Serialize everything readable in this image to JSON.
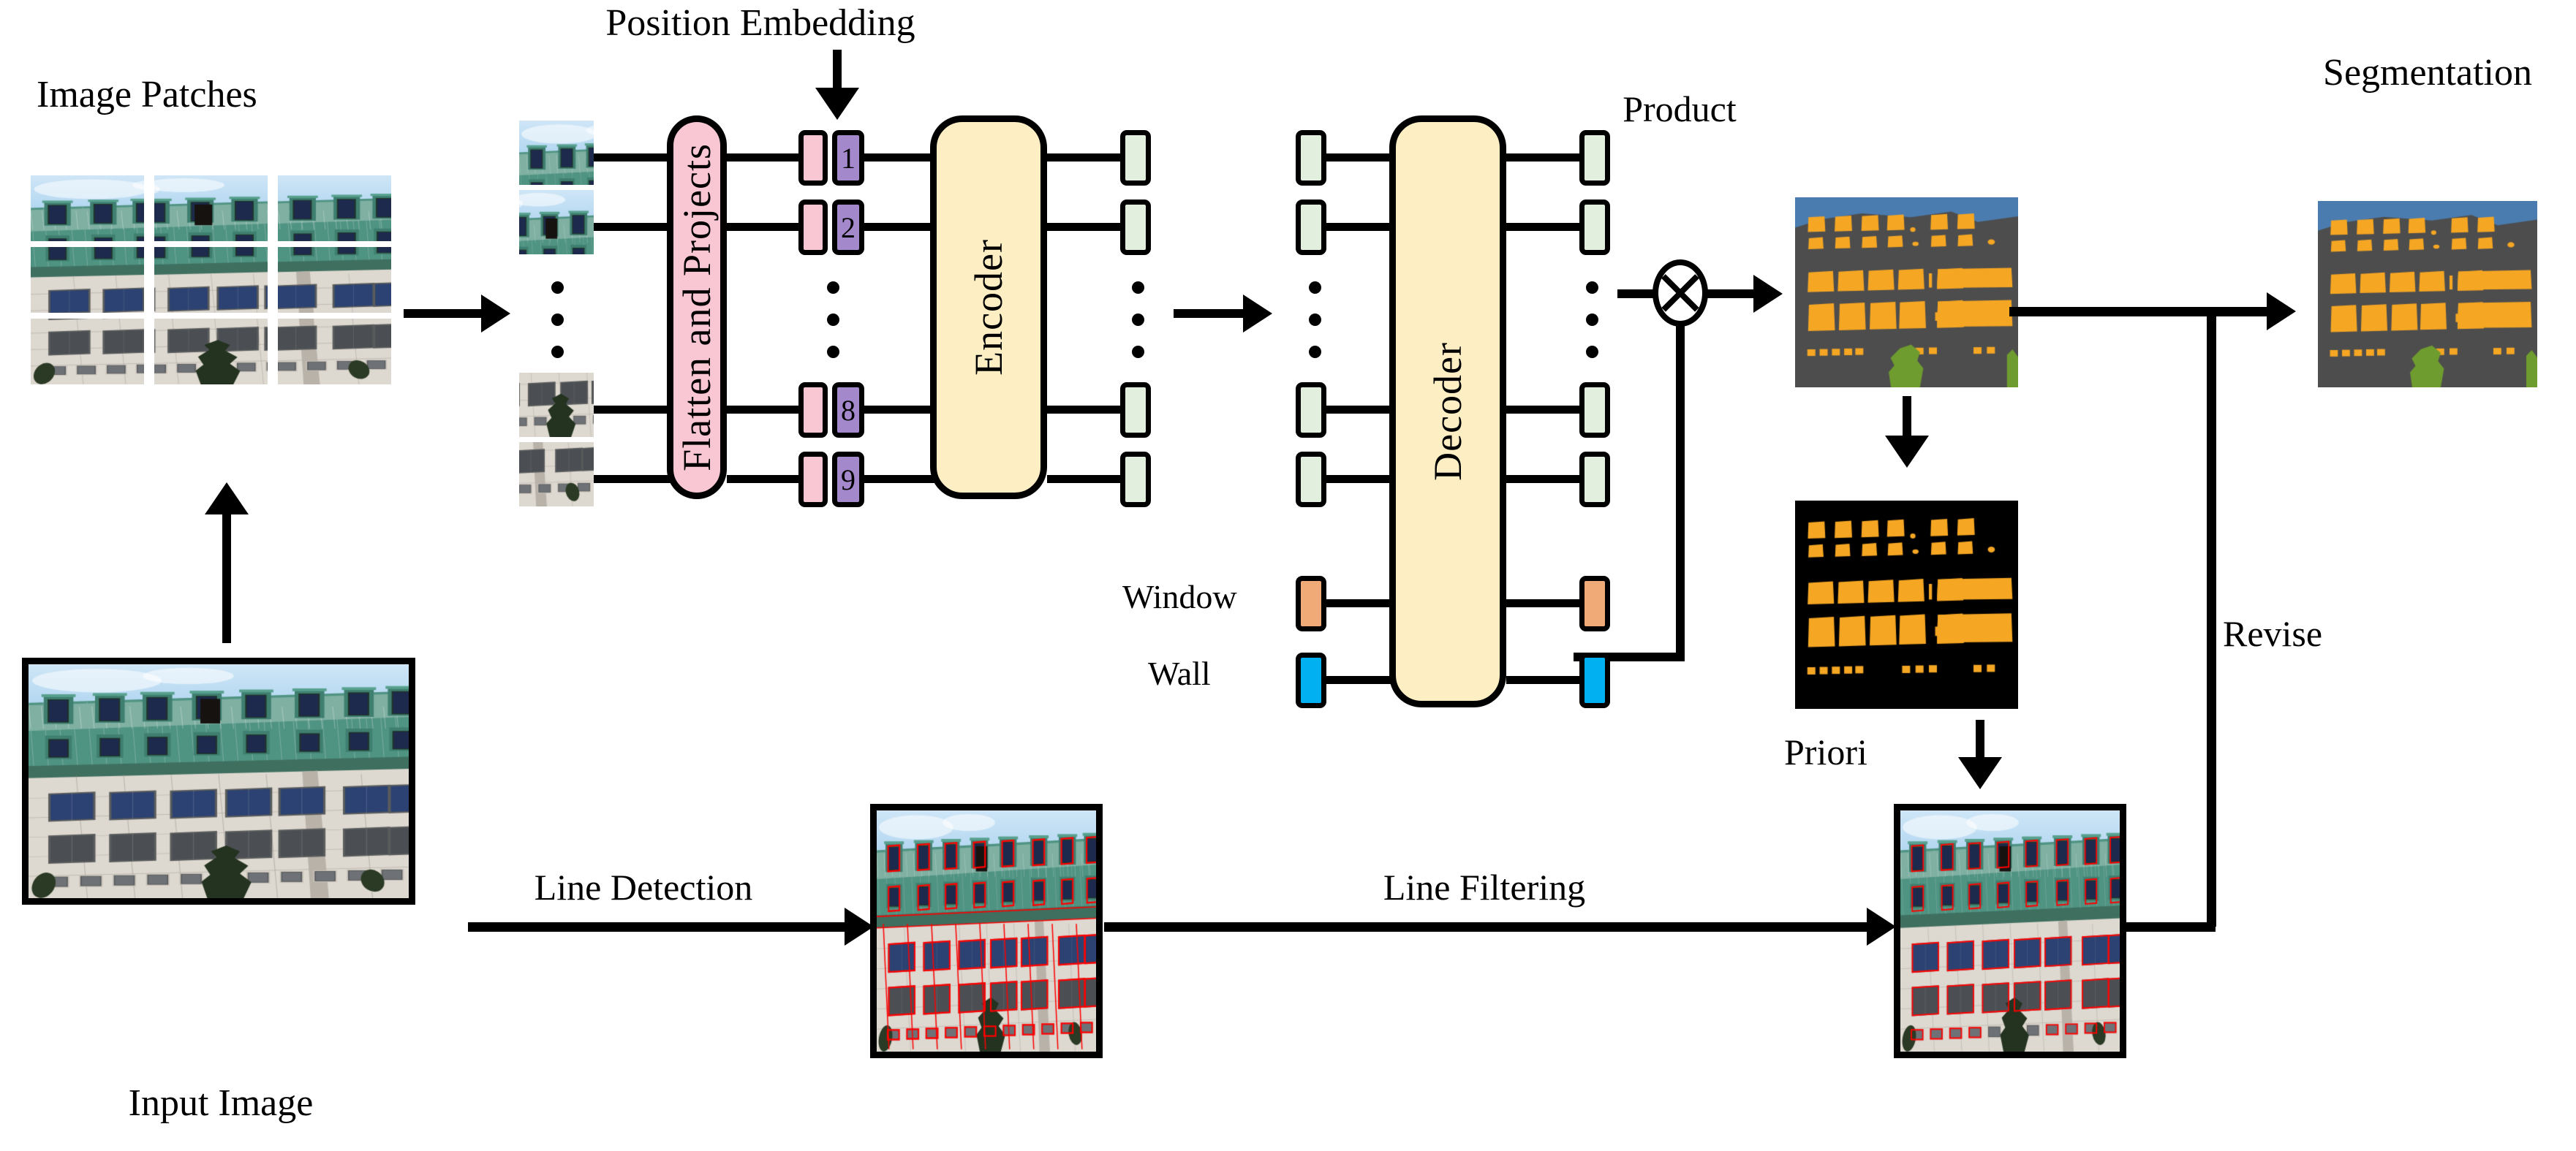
{
  "title": "Transformer facade segmentation pipeline diagram",
  "labels": {
    "image_patches": "Image Patches",
    "position_embedding": "Position Embedding",
    "input_image": "Input Image",
    "segmentation": "Segmentation",
    "product": "Product",
    "priori": "Priori",
    "revise": "Revise",
    "line_detection": "Line Detection",
    "line_filtering": "Line Filtering",
    "window": "Window",
    "wall": "Wall"
  },
  "blocks": {
    "flatten": "Flatten and Projects",
    "encoder": "Encoder",
    "decoder": "Decoder"
  },
  "position_tokens": [
    "1",
    "2",
    "8",
    "9"
  ],
  "colors": {
    "flatten_fill": "#f9c6d3",
    "encoder_fill": "#fdeec3",
    "decoder_fill": "#fdeec3",
    "patch_token_fill": "#f9c6d3",
    "pos_token_fill": "#a488cc",
    "feature_token_fill": "#e2eede",
    "window_token_fill": "#f0aa78",
    "wall_token_fill": "#00b0f0",
    "seg_wall": "#4d4d4d",
    "seg_window": "#f5a623",
    "seg_sky": "#4a7cb0",
    "seg_tree": "#6f9c2f",
    "mask_bg": "#000000",
    "line_overlay": "#ff0000",
    "stroke": "#000000"
  },
  "chart_data": {
    "type": "diagram",
    "nodes": [
      "Input Image",
      "Image Patches",
      "Flatten and Projects",
      "Position Embedding",
      "Encoder",
      "Decoder",
      "Window",
      "Wall",
      "Product",
      "Priori",
      "Line Detection",
      "Line Filtering",
      "Revise",
      "Segmentation"
    ],
    "edges": [
      {
        "from": "Input Image",
        "to": "Image Patches"
      },
      {
        "from": "Image Patches",
        "to": "Flatten and Projects"
      },
      {
        "from": "Position Embedding",
        "to": "Patch Tokens"
      },
      {
        "from": "Patch Tokens",
        "to": "Encoder"
      },
      {
        "from": "Encoder",
        "to": "Decoder"
      },
      {
        "from": "Decoder",
        "to": "Product"
      },
      {
        "from": "Product",
        "to": "Segmentation Map"
      },
      {
        "from": "Segmentation Map",
        "to": "Priori"
      },
      {
        "from": "Input Image",
        "to": "Line Detection"
      },
      {
        "from": "Line Detection",
        "to": "Line Filtering"
      },
      {
        "from": "Line Filtering",
        "to": "Revise"
      },
      {
        "from": "Revise",
        "to": "Segmentation"
      }
    ],
    "patch_grid": {
      "rows": 3,
      "cols": 3
    }
  }
}
